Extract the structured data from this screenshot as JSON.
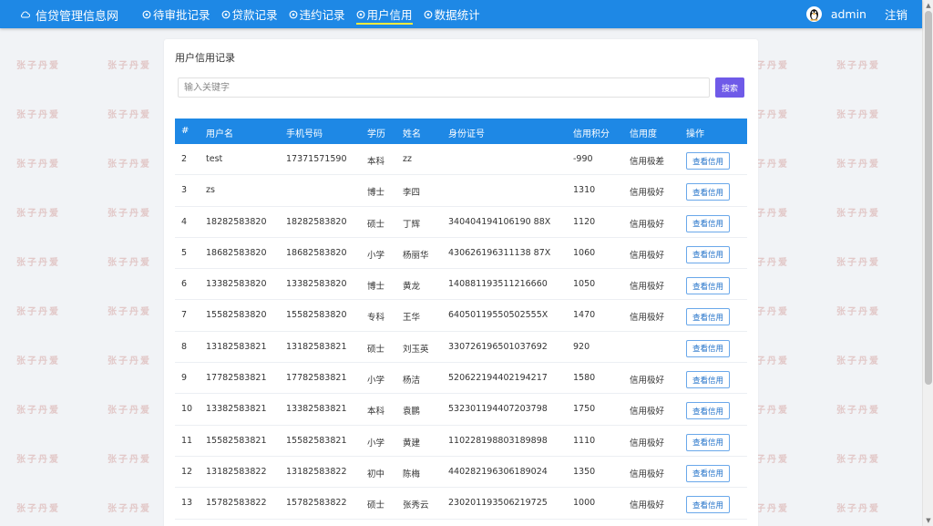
{
  "app": {
    "brand": "信贷管理信息网"
  },
  "nav": {
    "items": [
      {
        "label": "待审批记录",
        "active": false
      },
      {
        "label": "贷款记录",
        "active": false
      },
      {
        "label": "违约记录",
        "active": false
      },
      {
        "label": "用户信用",
        "active": true
      },
      {
        "label": "数据统计",
        "active": false
      }
    ]
  },
  "user": {
    "name": "admin",
    "logout": "注销"
  },
  "watermark_text": "张子丹爱",
  "page": {
    "title": "用户信用记录",
    "search_placeholder": "输入关键字",
    "search_button": "搜索"
  },
  "table": {
    "headers": [
      "#",
      "用户名",
      "手机号码",
      "学历",
      "姓名",
      "身份证号",
      "信用积分",
      "信用度",
      "操作"
    ],
    "action_label": "查看信用",
    "rows": [
      {
        "id": "2",
        "username": "test",
        "phone": "17371571590",
        "edu": "本科",
        "name": "zz",
        "idcard": "",
        "score": "-990",
        "level": "信用极差"
      },
      {
        "id": "3",
        "username": "zs",
        "phone": "",
        "edu": "博士",
        "name": "李四",
        "idcard": "",
        "score": "1310",
        "level": "信用极好"
      },
      {
        "id": "4",
        "username": "18282583820",
        "phone": "18282583820",
        "edu": "硕士",
        "name": "丁辉",
        "idcard": "340404194106190 88X",
        "score": "1120",
        "level": "信用极好"
      },
      {
        "id": "5",
        "username": "18682583820",
        "phone": "18682583820",
        "edu": "小学",
        "name": "杨丽华",
        "idcard": "430626196311138 87X",
        "score": "1060",
        "level": "信用极好"
      },
      {
        "id": "6",
        "username": "13382583820",
        "phone": "13382583820",
        "edu": "博士",
        "name": "黄龙",
        "idcard": "140881193511216660",
        "score": "1050",
        "level": "信用极好"
      },
      {
        "id": "7",
        "username": "15582583820",
        "phone": "15582583820",
        "edu": "专科",
        "name": "王华",
        "idcard": "64050119550502555X",
        "score": "1470",
        "level": "信用极好"
      },
      {
        "id": "8",
        "username": "13182583821",
        "phone": "13182583821",
        "edu": "硕士",
        "name": "刘玉英",
        "idcard": "330726196501037692",
        "score": "920",
        "level": ""
      },
      {
        "id": "9",
        "username": "17782583821",
        "phone": "17782583821",
        "edu": "小学",
        "name": "杨洁",
        "idcard": "520622194402194217",
        "score": "1580",
        "level": "信用极好"
      },
      {
        "id": "10",
        "username": "13382583821",
        "phone": "13382583821",
        "edu": "本科",
        "name": "袁鹏",
        "idcard": "532301194407203798",
        "score": "1750",
        "level": "信用极好"
      },
      {
        "id": "11",
        "username": "15582583821",
        "phone": "15582583821",
        "edu": "小学",
        "name": "黄建",
        "idcard": "110228198803189898",
        "score": "1110",
        "level": "信用极好"
      },
      {
        "id": "12",
        "username": "13182583822",
        "phone": "13182583822",
        "edu": "初中",
        "name": "陈梅",
        "idcard": "440282196306189024",
        "score": "1350",
        "level": "信用极好"
      },
      {
        "id": "13",
        "username": "15782583822",
        "phone": "15782583822",
        "edu": "硕士",
        "name": "张秀云",
        "idcard": "230201193506219725",
        "score": "1000",
        "level": "信用极好"
      }
    ]
  },
  "colors": {
    "nav_bg": "#1e88e5",
    "active_underline": "#ffeb3b",
    "search_button": "#6f5ae8",
    "table_header": "#1e88e5"
  }
}
